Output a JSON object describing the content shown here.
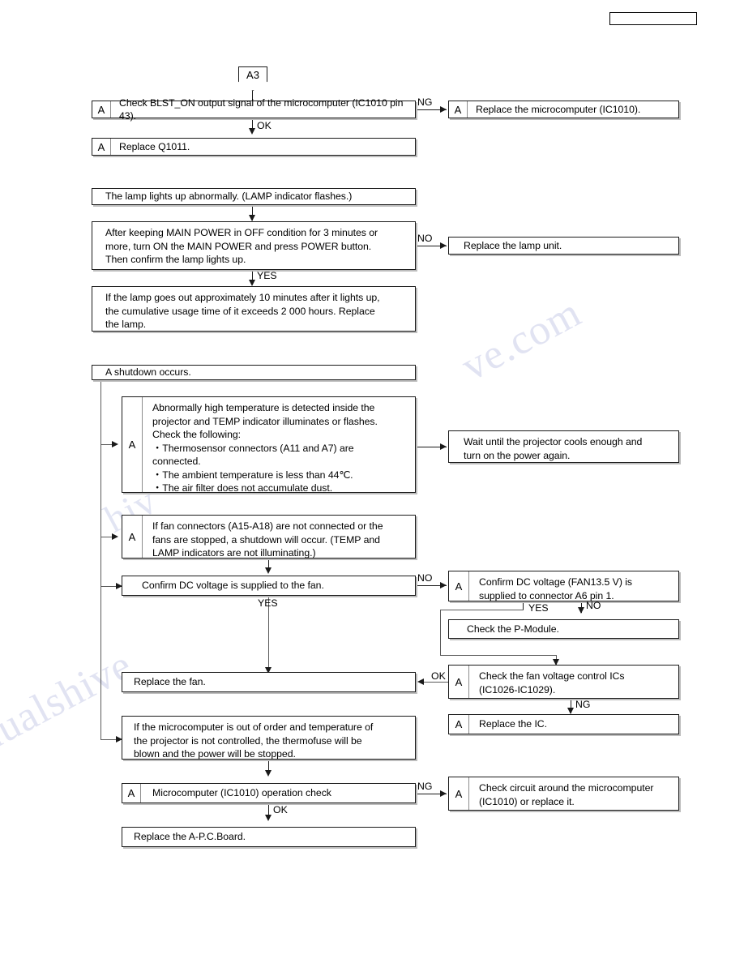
{
  "page": {
    "header_box": {
      "text": ""
    }
  },
  "connector": {
    "a3": "A3"
  },
  "marker_label": "A",
  "sections": {
    "blst": {
      "check_blst": "Check BLST_ON output signal of the microcomputer (IC1010 pin 43).",
      "check_blst_ok": "OK",
      "check_blst_ng": "NG",
      "replace_q1011": "Replace Q1011.",
      "replace_micom": "Replace the microcomputer (IC1010)."
    },
    "lamp": {
      "title": "The lamp lights up abnormally. (LAMP indicator flashes.)",
      "confirm_lamp": "After keeping MAIN POWER in OFF condition for 3 minutes or\nmore, turn ON the MAIN POWER and press POWER button.\nThen confirm the lamp lights up.",
      "confirm_yes": "YES",
      "confirm_no": "NO",
      "replace_lamp_unit": "Replace the lamp unit.",
      "cumulative": "If the lamp goes out approximately 10 minutes after it lights up,\nthe cumulative usage time of it exceeds 2 000 hours.  Replace\nthe lamp."
    },
    "shutdown": {
      "title": "A shutdown occurs.",
      "high_temp": "Abnormally high temperature is detected inside the\nprojector and TEMP indicator illuminates or flashes.\nCheck the following:\n・Thermosensor connectors (A11 and A7) are\n   connected.\n・The ambient temperature is less than 44℃.\n・The air filter does not accumulate dust.",
      "wait_cool": "Wait until the projector cools enough and\nturn on the power again.",
      "fan_connectors": "If fan connectors (A15-A18) are not connected or the\nfans are stopped, a shutdown will occur. (TEMP and\nLAMP indicators are not illuminating.)",
      "confirm_dc_fan": "Confirm DC voltage is supplied to the fan.",
      "confirm_dc_fan_yes": "YES",
      "confirm_dc_fan_no": "NO",
      "confirm_dc_a6": "Confirm DC voltage (FAN13.5 V) is\nsupplied to connector A6 pin 1.",
      "confirm_dc_a6_yes": "YES",
      "confirm_dc_a6_no": "NO",
      "check_pmodule": "Check the P-Module.",
      "replace_fan": "Replace the fan.",
      "check_fan_ics": "Check the fan voltage control ICs\n(IC1026-IC1029).",
      "check_fan_ics_ok": "OK",
      "check_fan_ics_ng": "NG",
      "replace_ic": "Replace the IC.",
      "thermofuse": "If the microcomputer is out of order and temperature of\nthe projector is not controlled, the thermofuse will be\nblown and the power will be stopped.",
      "micom_check": "Microcomputer (IC1010) operation check",
      "micom_check_ok": "OK",
      "micom_check_ng": "NG",
      "check_circuit_micom": "Check circuit around the microcomputer\n(IC1010) or replace it.",
      "replace_apc_board": "Replace the A-P.C.Board."
    }
  },
  "watermark": {
    "line1": "ve.com",
    "line2": "anualshive",
    "line3": "hiv"
  },
  "colors": {
    "line": "#1a1a1a",
    "shadow": "#bdbdbd",
    "watermark": "#c9cde8",
    "background": "#ffffff"
  }
}
